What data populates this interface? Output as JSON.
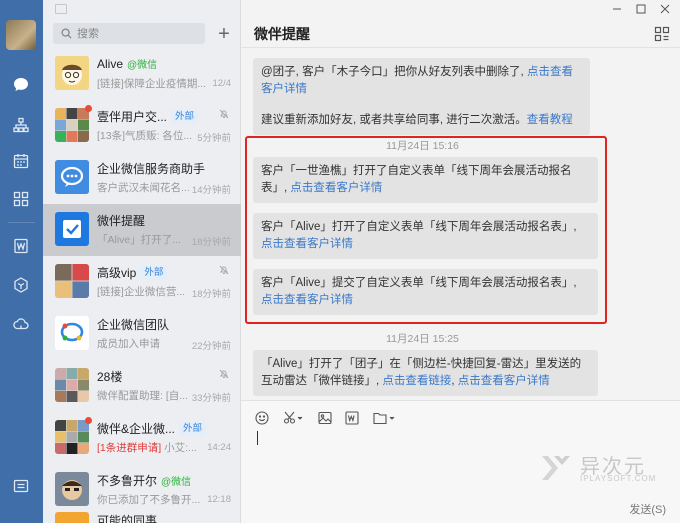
{
  "sidebar": {
    "icons": [
      "chat-icon",
      "org-icon",
      "calendar-icon",
      "apps-icon",
      "doc-icon",
      "cube-icon",
      "cloud-icon",
      "menu-icon"
    ]
  },
  "search": {
    "placeholder": "搜索",
    "add_label": "+"
  },
  "chats": [
    {
      "name": "Alive",
      "tag": "@微信",
      "preview": "[链接]保障企业疫情期...",
      "time": "12/4"
    },
    {
      "name": "壹伴用户交...",
      "tag": "外部",
      "preview": "[13条]气质贩: 各位...",
      "time": "5分钟前"
    },
    {
      "name": "企业微信服务商助手",
      "tag": "",
      "preview": "客户武汉未闻花名...",
      "time": "14分钟前"
    },
    {
      "name": "微伴提醒",
      "tag": "",
      "preview": "「Alive」打开了...",
      "time": "18分钟前"
    },
    {
      "name": "高级vip",
      "tag": "外部",
      "preview": "[链接]企业微信营...",
      "time": "18分钟前"
    },
    {
      "name": "企业微信团队",
      "tag": "",
      "preview": "成员加入申请",
      "time": "22分钟前"
    },
    {
      "name": "28楼",
      "tag": "",
      "preview": "微伴配置助理: [自...",
      "time": "33分钟前"
    },
    {
      "name": "微伴&企业微...",
      "tag": "外部",
      "preview_alert": "[1条进群申请]",
      "preview": " 小艾:...",
      "time": "14:24"
    },
    {
      "name": "不多鲁开尔",
      "tag": "@微信",
      "preview": "你已添加了不多鲁开...",
      "time": "12:18"
    },
    {
      "name": "可能的同事",
      "tag": "",
      "preview": "",
      "time": ""
    }
  ],
  "header": {
    "title": "微伴提醒"
  },
  "messages": {
    "m1_pre": "@团子, 客户「木子今口」把你从好友列表中删除了, ",
    "m1_link": "点击查看客户详情",
    "m1_line2": "建议重新添加好友, 或者共享给同事, 进行二次激活。",
    "m1_link2": "查看教程",
    "stamp1": "11月24日 15:16",
    "m2_pre": "客户「一世渔樵」打开了自定义表单「线下周年会展活动报名表」, ",
    "m2_link": "点击查看客户详情",
    "m3_pre": "客户「Alive」打开了自定义表单「线下周年会展活动报名表」, ",
    "m3_link": "点击查看客户详情",
    "m4_pre": "客户「Alive」提交了自定义表单「线下周年会展活动报名表」, ",
    "m4_link": "点击查看客户详情",
    "stamp2": "11月24日 15:25",
    "m5_pre": "「Alive」打开了「团子」在「侧边栏-快捷回复-雷达」里发送的互动雷达「微伴链接」, ",
    "m5_link1": "点击查看链接",
    "m5_sep": ", ",
    "m5_link2": "点击查看客户详情"
  },
  "composer": {
    "send_label": "发送(S)"
  },
  "watermark": {
    "brand": "异次元",
    "url": "IPLAYSOFT.COM"
  },
  "colors": {
    "rail": "#3f6ea8",
    "link": "#3a78c9",
    "highlight_box": "#e02424",
    "wechat_green": "#2ab33a"
  }
}
